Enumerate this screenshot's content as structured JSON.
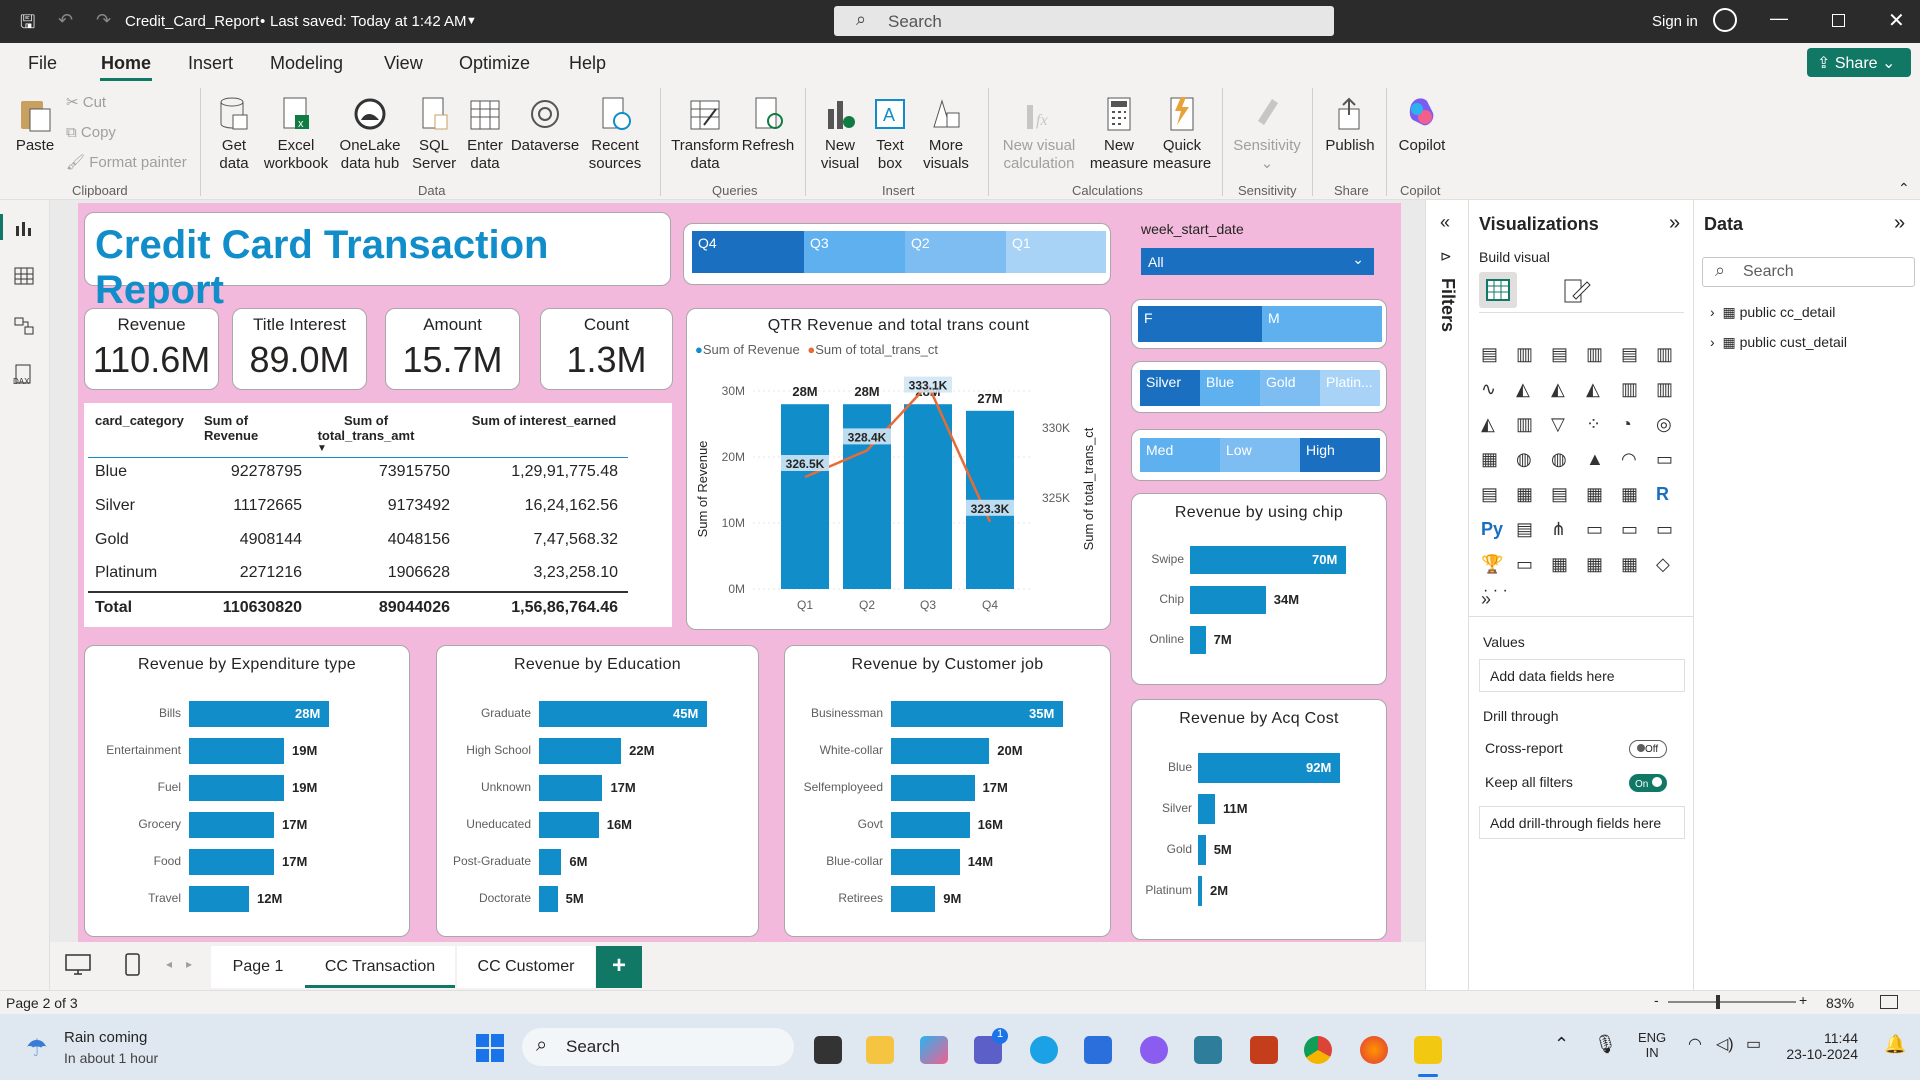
{
  "titlebar": {
    "doc_title": "Credit_Card_Report",
    "saved_status": "Last saved: Today at 1:42 AM",
    "search_placeholder": "Search",
    "sign_in": "Sign in"
  },
  "menu": {
    "items": [
      "File",
      "Home",
      "Insert",
      "Modeling",
      "View",
      "Optimize",
      "Help"
    ],
    "active": "Home",
    "share_label": "Share"
  },
  "ribbon": {
    "clipboard": {
      "paste": "Paste",
      "cut": "Cut",
      "copy": "Copy",
      "format_painter": "Format painter",
      "group": "Clipboard"
    },
    "data": {
      "get_data": "Get data",
      "excel": "Excel workbook",
      "onelake": "OneLake data hub",
      "sql": "SQL Server",
      "enter": "Enter data",
      "dataverse": "Dataverse",
      "recent": "Recent sources",
      "group": "Data"
    },
    "queries": {
      "transform": "Transform data",
      "refresh": "Refresh",
      "group": "Queries"
    },
    "insert": {
      "new_visual": "New visual",
      "text_box": "Text box",
      "more_visuals": "More visuals",
      "group": "Insert"
    },
    "calculations": {
      "new_visual_calc": "New visual calculation",
      "new_measure": "New measure",
      "quick_measure": "Quick measure",
      "group": "Calculations"
    },
    "sensitivity": {
      "label": "Sensitivity",
      "group": "Sensitivity"
    },
    "share": {
      "publish": "Publish",
      "group": "Share"
    },
    "copilot": {
      "label": "Copilot",
      "group": "Copilot"
    }
  },
  "report": {
    "title": "Credit Card Transaction Report",
    "quarter_slicer": [
      "Q4",
      "Q3",
      "Q2",
      "Q1"
    ],
    "week_slicer": {
      "label": "week_start_date",
      "value": "All"
    },
    "gender_slicer": [
      "F",
      "M"
    ],
    "card_slicer": [
      "Silver",
      "Blue",
      "Gold",
      "Platin..."
    ],
    "income_slicer": [
      "Med",
      "Low",
      "High"
    ],
    "kpis": [
      {
        "label": "Revenue",
        "value": "110.6M"
      },
      {
        "label": "Title Interest",
        "value": "89.0M"
      },
      {
        "label": "Amount",
        "value": "15.7M"
      },
      {
        "label": "Count",
        "value": "1.3M"
      }
    ],
    "table": {
      "headers": [
        "card_category",
        "Sum of Revenue",
        "Sum of total_trans_amt",
        "Sum of interest_earned"
      ],
      "rows": [
        [
          "Blue",
          "92278795",
          "73915750",
          "1,29,91,775.48"
        ],
        [
          "Silver",
          "11172665",
          "9173492",
          "16,24,162.56"
        ],
        [
          "Gold",
          "4908144",
          "4048156",
          "7,47,568.32"
        ],
        [
          "Platinum",
          "2271216",
          "1906628",
          "3,23,258.10"
        ]
      ],
      "total": [
        "Total",
        "110630820",
        "89044026",
        "1,56,86,764.46"
      ]
    }
  },
  "chart_data": [
    {
      "type": "bar+line",
      "title": "QTR Revenue and total trans count",
      "categories": [
        "Q1",
        "Q2",
        "Q3",
        "Q4"
      ],
      "series": [
        {
          "name": "Sum of Revenue",
          "values": [
            28,
            28,
            28,
            27
          ],
          "labels": [
            "28M",
            "28M",
            "28M",
            "27M"
          ],
          "axis": "left"
        },
        {
          "name": "Sum of total_trans_ct",
          "values": [
            326.5,
            328.4,
            333.1,
            323.3
          ],
          "labels": [
            "326.5K",
            "328.4K",
            "333.1K",
            "323.3K"
          ],
          "axis": "right"
        }
      ],
      "ylabel": "Sum of Revenue",
      "y2label": "Sum of total_trans_ct",
      "yticks": [
        "30M",
        "20M",
        "10M",
        "0M"
      ],
      "y2ticks": [
        "330K",
        "325K"
      ]
    },
    {
      "type": "bar",
      "title": "Revenue by Expenditure type",
      "categories": [
        "Bills",
        "Entertainment",
        "Fuel",
        "Grocery",
        "Food",
        "Travel"
      ],
      "values": [
        28,
        19,
        19,
        17,
        17,
        12
      ],
      "labels": [
        "28M",
        "19M",
        "19M",
        "17M",
        "17M",
        "12M"
      ]
    },
    {
      "type": "bar",
      "title": "Revenue by Education",
      "categories": [
        "Graduate",
        "High School",
        "Unknown",
        "Uneducated",
        "Post-Graduate",
        "Doctorate"
      ],
      "values": [
        45,
        22,
        17,
        16,
        6,
        5
      ],
      "labels": [
        "45M",
        "22M",
        "17M",
        "16M",
        "6M",
        "5M"
      ]
    },
    {
      "type": "bar",
      "title": "Revenue by Customer job",
      "categories": [
        "Businessman",
        "White-collar",
        "Selfemployeed",
        "Govt",
        "Blue-collar",
        "Retirees"
      ],
      "values": [
        35,
        20,
        17,
        16,
        14,
        9
      ],
      "labels": [
        "35M",
        "20M",
        "17M",
        "16M",
        "14M",
        "9M"
      ]
    },
    {
      "type": "bar",
      "title": "Revenue by using chip",
      "categories": [
        "Swipe",
        "Chip",
        "Online"
      ],
      "values": [
        70,
        34,
        7
      ],
      "labels": [
        "70M",
        "34M",
        "7M"
      ]
    },
    {
      "type": "bar",
      "title": "Revenue by Acq Cost",
      "categories": [
        "Blue",
        "Silver",
        "Gold",
        "Platinum"
      ],
      "values": [
        92,
        11,
        5,
        2
      ],
      "labels": [
        "92M",
        "11M",
        "5M",
        "2M"
      ]
    }
  ],
  "filters": {
    "label": "Filters"
  },
  "viz_pane": {
    "title": "Visualizations",
    "build_visual": "Build visual",
    "values_label": "Values",
    "values_placeholder": "Add data fields here",
    "drill_through": "Drill through",
    "cross_report": "Cross-report",
    "cross_report_state": "Off",
    "keep_filters": "Keep all filters",
    "keep_filters_state": "On",
    "drill_placeholder": "Add drill-through fields here"
  },
  "data_pane": {
    "title": "Data",
    "search_placeholder": "Search",
    "tables": [
      "public cc_detail",
      "public cust_detail"
    ]
  },
  "tabs": {
    "pages": [
      "Page 1",
      "CC Transaction",
      "CC Customer"
    ],
    "active": "CC Transaction",
    "add": "+"
  },
  "status": {
    "page": "Page 2 of 3",
    "zoom": "83%"
  },
  "taskbar": {
    "weather_title": "Rain coming",
    "weather_sub": "In about 1 hour",
    "search": "Search",
    "lang1": "ENG",
    "lang2": "IN",
    "time": "11:44",
    "date": "23-10-2024",
    "teams_badge": "1"
  },
  "colors": {
    "accent": "#118dca",
    "canvas": "#f2b9dc",
    "slicer_dark": "#1a6fc0",
    "slicer_light": "#8ec9f5",
    "line": "#e66c37"
  }
}
